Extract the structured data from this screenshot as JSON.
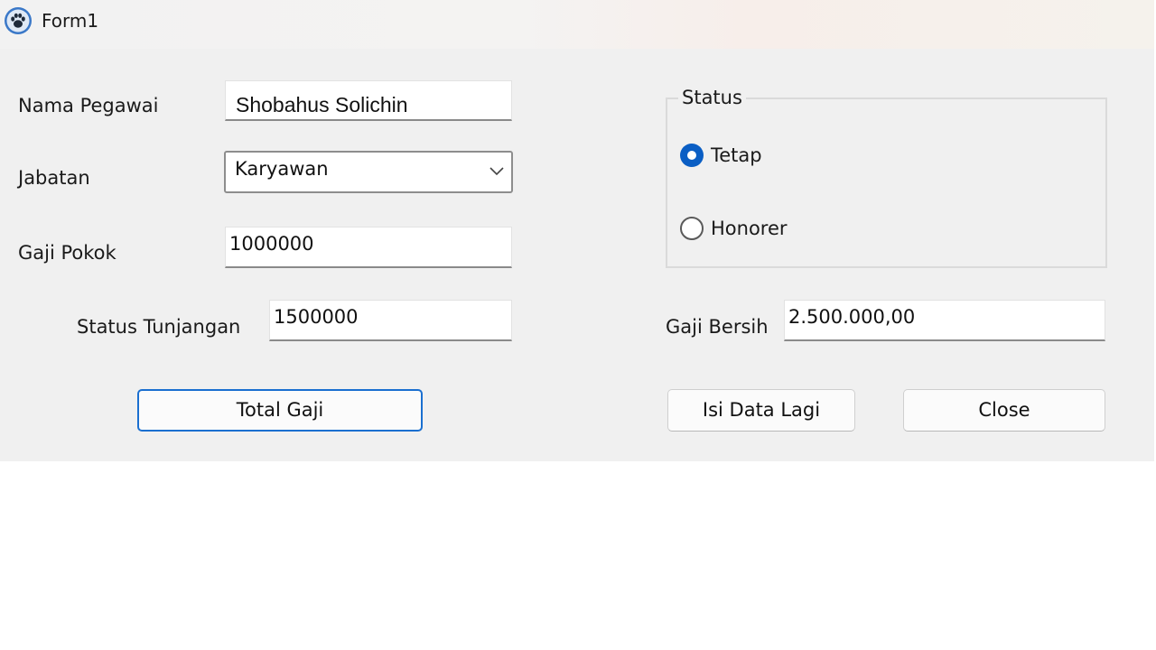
{
  "window": {
    "title": "Form1",
    "icon": "paw-icon"
  },
  "form": {
    "nama_pegawai": {
      "label": "Nama Pegawai",
      "value": "Shobahus Solichin"
    },
    "jabatan": {
      "label": "Jabatan",
      "value": "Karyawan"
    },
    "gaji_pokok": {
      "label": "Gaji Pokok",
      "value": "1000000"
    },
    "status_tunjangan": {
      "label": "Status Tunjangan",
      "value": "1500000"
    },
    "gaji_bersih": {
      "label": "Gaji Bersih",
      "value": "2.500.000,00"
    }
  },
  "status_group": {
    "title": "Status",
    "options": [
      {
        "label": "Tetap",
        "checked": true
      },
      {
        "label": "Honorer",
        "checked": false
      }
    ]
  },
  "buttons": {
    "total_gaji": "Total Gaji",
    "isi_data_lagi": "Isi Data Lagi",
    "close": "Close"
  },
  "colors": {
    "accent": "#0a5ec4",
    "form_background": "#f0f0f0"
  }
}
